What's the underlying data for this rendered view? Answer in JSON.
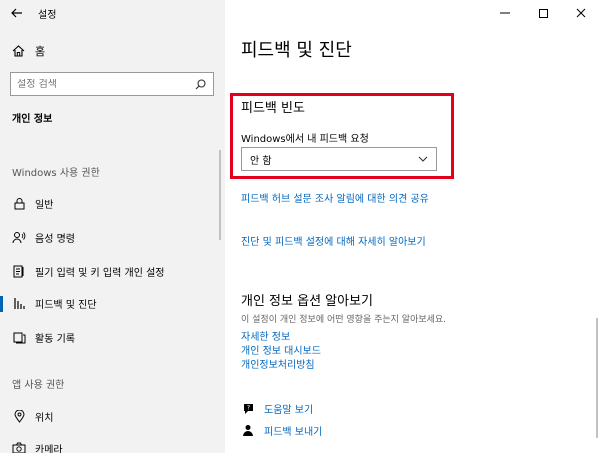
{
  "window": {
    "title": "설정",
    "back_icon": "arrow-left-icon",
    "controls": {
      "minimize": "—",
      "maximize": "☐",
      "close": "✕"
    }
  },
  "sidebar": {
    "home_label": "홈",
    "search_placeholder": "설정 검색",
    "section_title": "개인 정보",
    "group1_title": "Windows 사용 권한",
    "items": [
      {
        "label": "일반",
        "icon": "lock-icon"
      },
      {
        "label": "음성 명령",
        "icon": "speech-icon"
      },
      {
        "label": "필기 입력 및 키 입력 개인 설정",
        "icon": "pen-icon"
      },
      {
        "label": "피드백 및 진단",
        "icon": "feedback-icon",
        "active": true
      },
      {
        "label": "활동 기록",
        "icon": "activity-icon"
      }
    ],
    "group2_title": "앱 사용 권한",
    "items2": [
      {
        "label": "위치",
        "icon": "location-icon"
      },
      {
        "label": "카메라",
        "icon": "camera-icon"
      }
    ]
  },
  "main": {
    "page_title": "피드백 및 진단",
    "freq_title": "피드백 빈도",
    "freq_label": "Windows에서 내 피드백 요청",
    "freq_value": "안 함",
    "link_survey": "피드백 허브 설문 조사 알림에 대한 의견 공유",
    "link_diag": "진단 및 피드백 설정에 대해 자세히 알아보기",
    "privacy_title": "개인 정보 옵션 알아보기",
    "privacy_desc": "이 설정이 개인 정보에 어떤 영향을 주는지 알아보세요.",
    "privacy_links": [
      "자세한 정보",
      "개인 정보 대시보드",
      "개인정보처리방침"
    ],
    "help_label": "도움말 보기",
    "feedback_label": "피드백 보내기"
  },
  "colors": {
    "accent": "#0063b1",
    "link": "#0067c0",
    "highlight": "#e3001b"
  }
}
